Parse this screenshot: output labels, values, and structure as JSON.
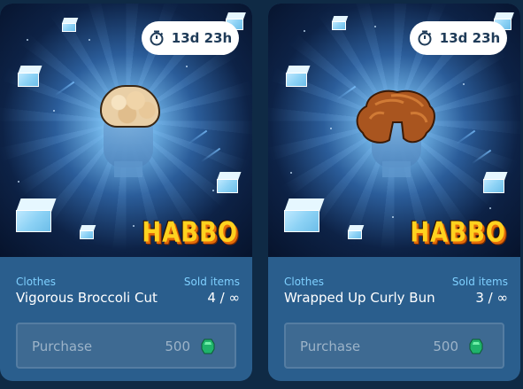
{
  "cards": [
    {
      "timer": "13d 23h",
      "logo": "HABBO",
      "category": "Clothes",
      "sold_label": "Sold items",
      "name": "Vigorous Broccoli Cut",
      "sold_count": "4 / ∞",
      "purchase_label": "Purchase",
      "price": "500",
      "currency_icon": "green-gem-icon"
    },
    {
      "timer": "13d 23h",
      "logo": "HABBO",
      "category": "Clothes",
      "sold_label": "Sold items",
      "name": "Wrapped Up Curly Bun",
      "sold_count": "3 / ∞",
      "purchase_label": "Purchase",
      "price": "500",
      "currency_icon": "green-gem-icon"
    }
  ],
  "colors": {
    "card_bg": "#2a5e8d",
    "accent_text": "#7fd0ff",
    "page_bg": "#0f2a45",
    "gem": "#1fb36b"
  }
}
